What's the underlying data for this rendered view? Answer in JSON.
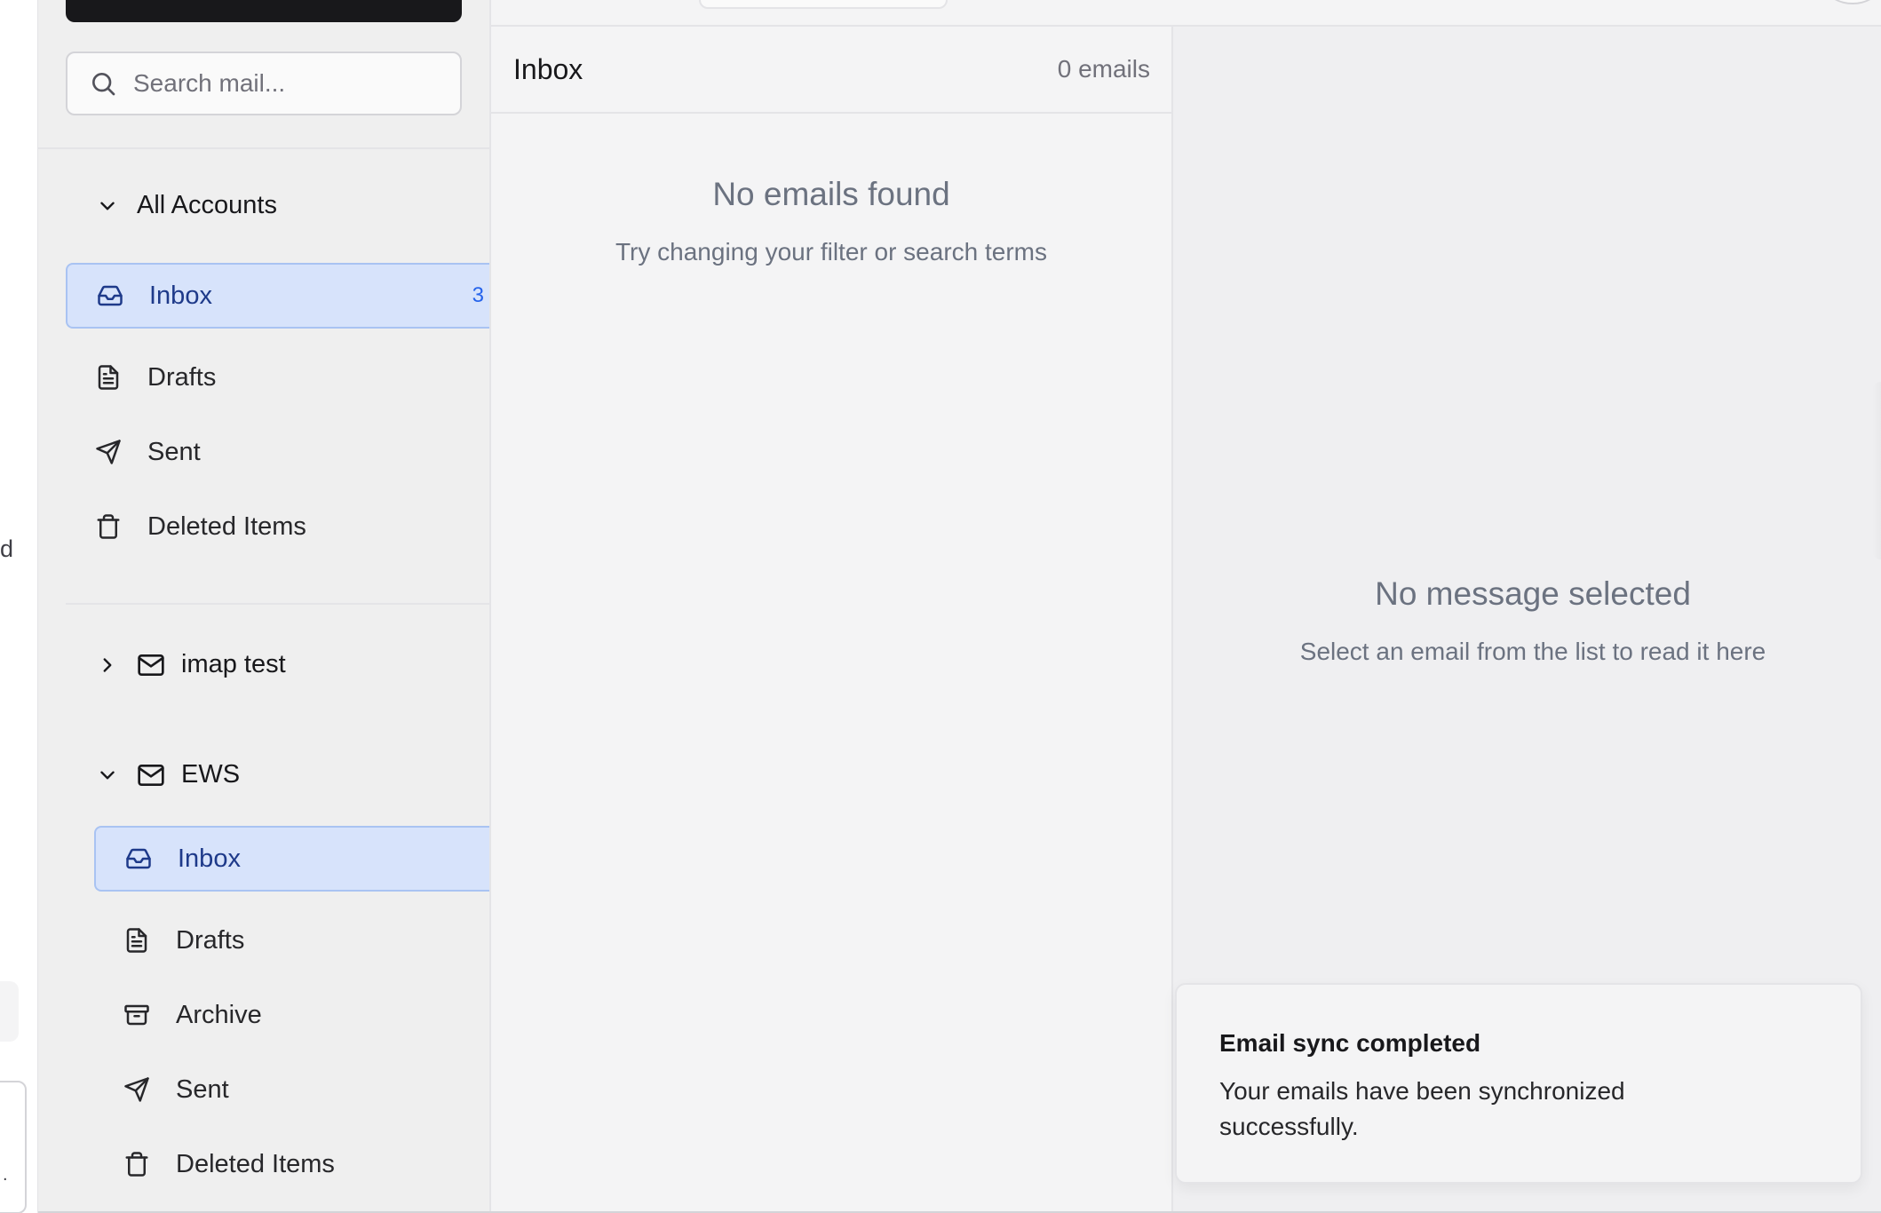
{
  "left_strip": {
    "fragment_text": "d",
    "card_fragment": "."
  },
  "search": {
    "placeholder": "Search mail..."
  },
  "all_accounts": {
    "label": "All Accounts",
    "folders": [
      {
        "label": "Inbox",
        "icon": "inbox-icon",
        "count": "3",
        "active": true
      },
      {
        "label": "Drafts",
        "icon": "file-text-icon"
      },
      {
        "label": "Sent",
        "icon": "send-icon"
      },
      {
        "label": "Deleted Items",
        "icon": "trash-icon"
      }
    ]
  },
  "accounts": [
    {
      "name": "imap test",
      "expanded": false,
      "icon": "mail-icon"
    },
    {
      "name": "EWS",
      "expanded": true,
      "icon": "mail-icon",
      "folders": [
        {
          "label": "Inbox",
          "icon": "inbox-icon",
          "active": true
        },
        {
          "label": "Drafts",
          "icon": "file-text-icon"
        },
        {
          "label": "Archive",
          "icon": "archive-icon"
        },
        {
          "label": "Sent",
          "icon": "send-icon"
        },
        {
          "label": "Deleted Items",
          "icon": "trash-icon"
        }
      ]
    }
  ],
  "list": {
    "title": "Inbox",
    "count": "0 emails",
    "empty_title": "No emails found",
    "empty_subtitle": "Try changing your filter or search terms"
  },
  "reading": {
    "empty_title": "No message selected",
    "empty_subtitle": "Select an email from the list to read it here"
  },
  "toast": {
    "title": "Email sync completed",
    "body": "Your emails have been synchronized successfully."
  },
  "colors": {
    "active_bg": "#d7e3fb",
    "active_text": "#1e3a8a",
    "badge": "#2563eb",
    "compose_bg": "#18181b"
  }
}
